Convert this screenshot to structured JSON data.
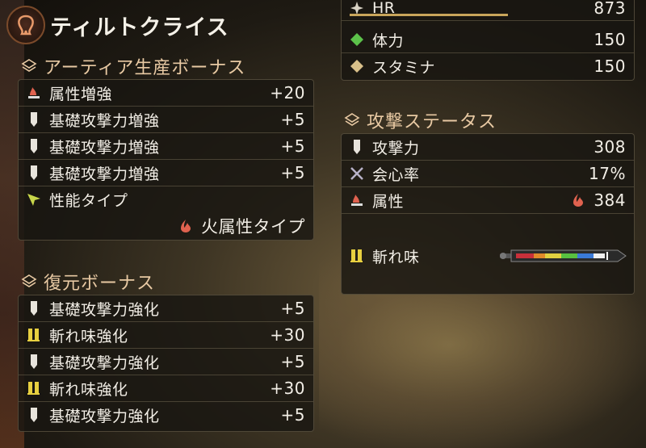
{
  "weapon": {
    "name": "ティルトクライス"
  },
  "artian_bonus": {
    "header": "アーティア生産ボーナス",
    "rows": [
      {
        "label": "属性増強",
        "value": "+20",
        "icon": "element-boost-icon"
      },
      {
        "label": "基礎攻撃力増強",
        "value": "+5",
        "icon": "attack-boost-icon"
      },
      {
        "label": "基礎攻撃力増強",
        "value": "+5",
        "icon": "attack-boost-icon"
      },
      {
        "label": "基礎攻撃力増強",
        "value": "+5",
        "icon": "attack-boost-icon"
      },
      {
        "label": "性能タイプ",
        "value": "",
        "icon": "performance-type-icon"
      }
    ],
    "type_value": "火属性タイプ"
  },
  "restore_bonus": {
    "header": "復元ボーナス",
    "rows": [
      {
        "label": "基礎攻撃力強化",
        "value": "+5",
        "icon": "attack-boost-icon"
      },
      {
        "label": "斬れ味強化",
        "value": "+30",
        "icon": "sharpness-icon"
      },
      {
        "label": "基礎攻撃力強化",
        "value": "+5",
        "icon": "attack-boost-icon"
      },
      {
        "label": "斬れ味強化",
        "value": "+30",
        "icon": "sharpness-icon"
      },
      {
        "label": "基礎攻撃力強化",
        "value": "+5",
        "icon": "attack-boost-icon"
      }
    ]
  },
  "hunter": {
    "hr_label": "HR",
    "hr_value": "873",
    "health_label": "体力",
    "health_value": "150",
    "stamina_label": "スタミナ",
    "stamina_value": "150"
  },
  "attack_status": {
    "header": "攻撃ステータス",
    "attack_label": "攻撃力",
    "attack_value": "308",
    "affinity_label": "会心率",
    "affinity_value": "17%",
    "element_label": "属性",
    "element_value": "384",
    "sharpness_label": "斬れ味"
  },
  "colors": {
    "accent_header": "#e8c9a3",
    "fire": "#e0624f",
    "health": "#5cc24a",
    "stamina": "#d9c08a"
  }
}
